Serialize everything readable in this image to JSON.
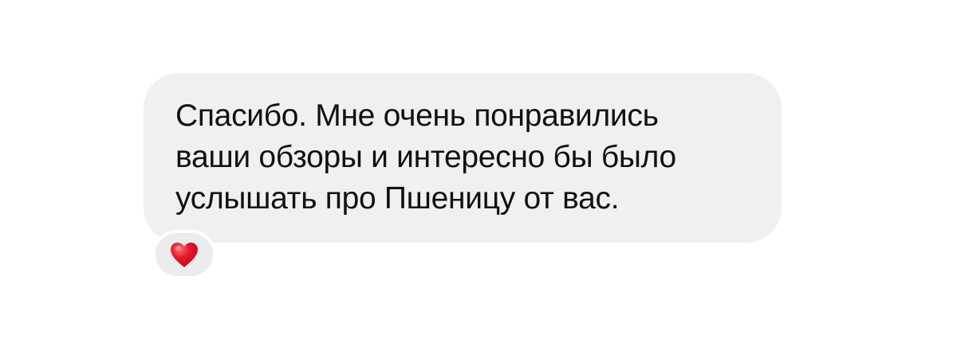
{
  "message": {
    "text": "Спасибо. Мне очень понравились\nваши обзоры и интересно бы было\nуслышать про Пшеницу от вас."
  },
  "reaction": {
    "icon": "heart-icon",
    "color": "#e0162b"
  }
}
